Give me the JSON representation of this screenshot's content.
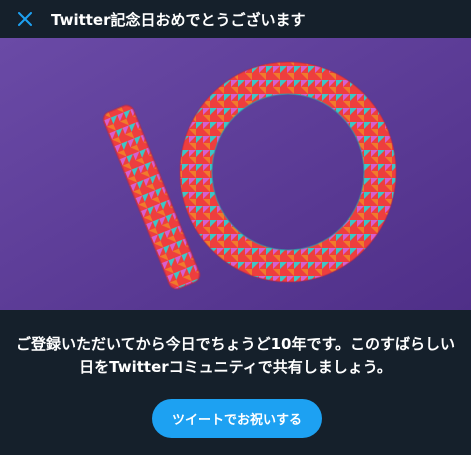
{
  "header": {
    "title": "Twitter記念日おめでとうございます",
    "close_icon": "close-icon"
  },
  "hero": {
    "image_description_icon": "folded-paper-number-10-illustration",
    "background_color": "#5b3a96"
  },
  "message": {
    "line1": "ご登録いただいてから今日でちょうど10年です。このすばらしい",
    "line2": "日をTwitterコミュニティで共有しましょう。"
  },
  "cta": {
    "label": "ツイートでお祝いする"
  },
  "colors": {
    "background": "#15202b",
    "accent": "#1da1f2"
  }
}
